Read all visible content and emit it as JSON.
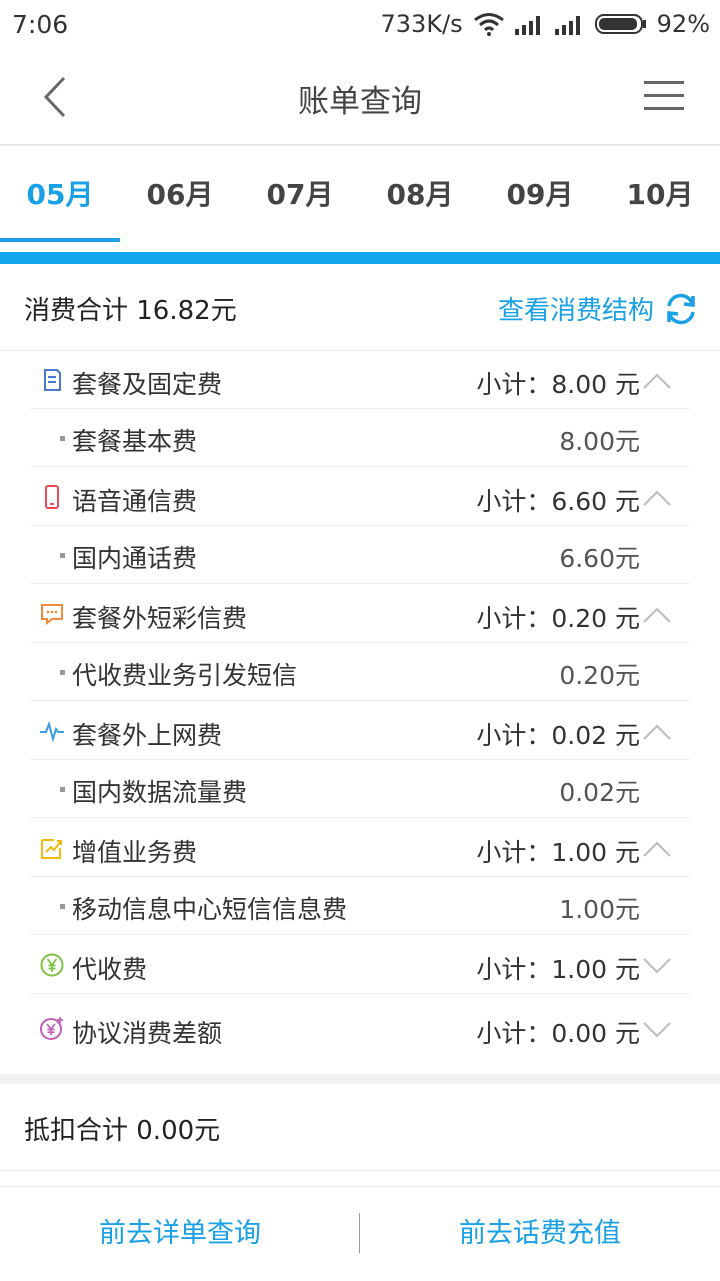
{
  "status": {
    "time": "7:06",
    "speed": "733K/s",
    "battery": "92%"
  },
  "header": {
    "title": "账单查询"
  },
  "tabs": [
    "05月",
    "06月",
    "07月",
    "08月",
    "09月",
    "10月"
  ],
  "summary": {
    "label": "消费合计 16.82元",
    "link": "查看消费结构"
  },
  "items": [
    {
      "type": "cat",
      "icon": "document-icon",
      "label": "套餐及固定费",
      "amount": "小计：8.00 元",
      "chev": "up"
    },
    {
      "type": "sub",
      "label": "套餐基本费",
      "amount": "8.00元"
    },
    {
      "type": "cat",
      "icon": "phone-icon",
      "label": "语音通信费",
      "amount": "小计：6.60 元",
      "chev": "up"
    },
    {
      "type": "sub",
      "label": "国内通话费",
      "amount": "6.60元"
    },
    {
      "type": "cat",
      "icon": "message-icon",
      "label": "套餐外短彩信费",
      "amount": "小计：0.20 元",
      "chev": "up"
    },
    {
      "type": "sub",
      "label": "代收费业务引发短信",
      "amount": "0.20元"
    },
    {
      "type": "cat",
      "icon": "pulse-icon",
      "label": "套餐外上网费",
      "amount": "小计：0.02 元",
      "chev": "up"
    },
    {
      "type": "sub",
      "label": "国内数据流量费",
      "amount": "0.02元"
    },
    {
      "type": "cat",
      "icon": "chart-edit-icon",
      "label": "增值业务费",
      "amount": "小计：1.00 元",
      "chev": "up"
    },
    {
      "type": "sub",
      "label": "移动信息中心短信信息费",
      "amount": "1.00元"
    },
    {
      "type": "cat",
      "icon": "yuan-circle-icon",
      "label": "代收费",
      "amount": "小计：1.00 元",
      "chev": "down"
    },
    {
      "type": "cat",
      "icon": "yuan-plus-icon",
      "label": "协议消费差额",
      "amount": "小计：0.00 元",
      "chev": "down"
    }
  ],
  "deduct": {
    "label": "抵扣合计   0.00元"
  },
  "bottom": {
    "left": "前去详单查询",
    "right": "前去话费充值"
  },
  "colors": {
    "accent": "#1aa0e6",
    "bar": "#12a6ee"
  }
}
